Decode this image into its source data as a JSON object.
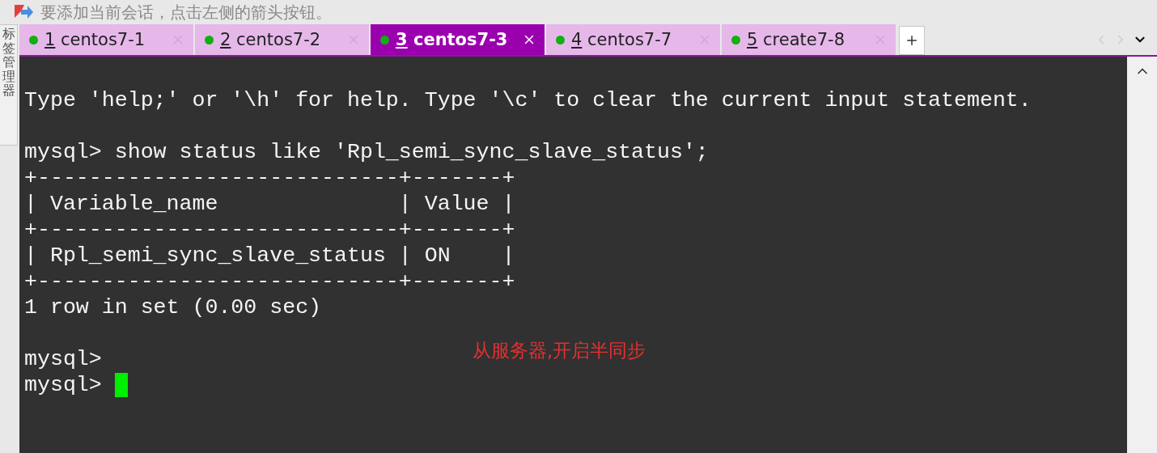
{
  "hint_bar": {
    "text": "要添加当前会话，点击左侧的箭头按钮。"
  },
  "side_panel": {
    "label": "标签管理器"
  },
  "tabs": [
    {
      "number": "1",
      "label": "centos7-1",
      "selected": false,
      "connected": true
    },
    {
      "number": "2",
      "label": "centos7-2",
      "selected": false,
      "connected": true
    },
    {
      "number": "3",
      "label": "centos7-3",
      "selected": true,
      "connected": true
    },
    {
      "number": "4",
      "label": "centos7-7",
      "selected": false,
      "connected": true
    },
    {
      "number": "5",
      "label": "create7-8",
      "selected": false,
      "connected": true
    }
  ],
  "terminal": {
    "lines": [
      {
        "kind": "blank"
      },
      {
        "kind": "text",
        "text": "Type 'help;' or '\\h' for help. Type '\\c' to clear the current input statement."
      },
      {
        "kind": "blank"
      },
      {
        "kind": "text",
        "text": "mysql> show status like 'Rpl_semi_sync_slave_status';"
      },
      {
        "kind": "text",
        "text": "+----------------------------+-------+"
      },
      {
        "kind": "text",
        "text": "| Variable_name              | Value |"
      },
      {
        "kind": "text",
        "text": "+----------------------------+-------+"
      },
      {
        "kind": "text",
        "text": "| Rpl_semi_sync_slave_status | ON    |"
      },
      {
        "kind": "text",
        "text": "+----------------------------+-------+"
      },
      {
        "kind": "text",
        "text": "1 row in set (0.00 sec)"
      },
      {
        "kind": "blank"
      },
      {
        "kind": "text",
        "text": "mysql>"
      },
      {
        "kind": "prompt",
        "text": "mysql> ",
        "cursor": true
      }
    ],
    "annotation": {
      "text": "从服务器,开启半同步"
    }
  }
}
